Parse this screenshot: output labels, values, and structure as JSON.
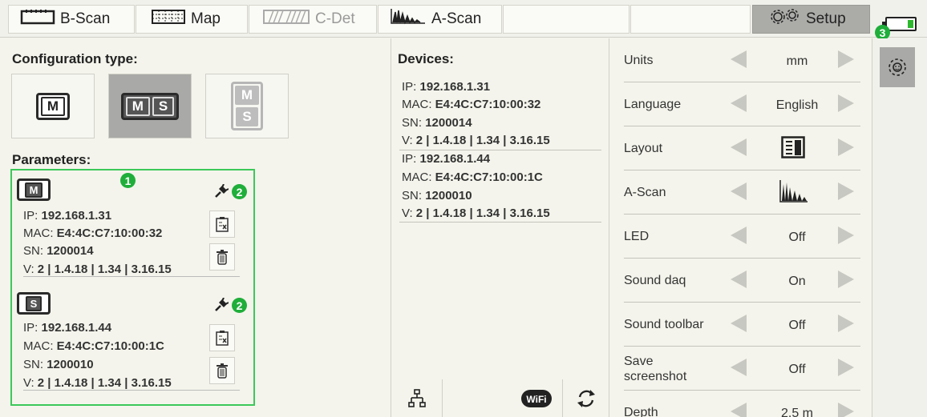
{
  "toolbar": {
    "tabs": [
      {
        "label": "B-Scan",
        "icon": "bscan-icon",
        "state": "normal"
      },
      {
        "label": "Map",
        "icon": "map-icon",
        "state": "normal"
      },
      {
        "label": "C-Det",
        "icon": "cdet-icon",
        "state": "disabled"
      },
      {
        "label": "A-Scan",
        "icon": "ascan-icon",
        "state": "normal"
      },
      {
        "label": "Setup",
        "icon": "gears-icon",
        "state": "active"
      }
    ],
    "battery_badge": "3",
    "battery_level_fraction": 0.2
  },
  "config": {
    "title": "Configuration type:",
    "options": [
      {
        "cells": [
          "M"
        ],
        "state": "normal"
      },
      {
        "cells": [
          "M",
          "S"
        ],
        "state": "selected"
      },
      {
        "cells": [
          "M",
          "S"
        ],
        "state": "disabled"
      }
    ]
  },
  "parameters": {
    "title": "Parameters:",
    "box_badge": "1",
    "devices": [
      {
        "type": "M",
        "badge": "2",
        "ip_label": "IP:",
        "ip": "192.168.1.31",
        "mac_label": "MAC:",
        "mac": "E4:4C:C7:10:00:32",
        "sn_label": "SN:",
        "sn": "1200014",
        "v_label": "V:",
        "v": "2 | 1.4.18 | 1.34 | 3.16.15"
      },
      {
        "type": "S",
        "badge": "2",
        "ip_label": "IP:",
        "ip": "192.168.1.44",
        "mac_label": "MAC:",
        "mac": "E4:4C:C7:10:00:1C",
        "sn_label": "SN:",
        "sn": "1200010",
        "v_label": "V:",
        "v": "2 | 1.4.18 | 1.34 | 3.16.15"
      }
    ]
  },
  "devices": {
    "title": "Devices:",
    "list": [
      {
        "ip_label": "IP:",
        "ip": "192.168.1.31",
        "mac_label": "MAC:",
        "mac": "E4:4C:C7:10:00:32",
        "sn_label": "SN:",
        "sn": "1200014",
        "v_label": "V:",
        "v": "2 | 1.4.18 | 1.34 | 3.16.15"
      },
      {
        "ip_label": "IP:",
        "ip": "192.168.1.44",
        "mac_label": "MAC:",
        "mac": "E4:4C:C7:10:00:1C",
        "sn_label": "SN:",
        "sn": "1200010",
        "v_label": "V:",
        "v": "2 | 1.4.18 | 1.34 | 3.16.15"
      }
    ],
    "wifi_label": "WiFi"
  },
  "settings": {
    "rows": [
      {
        "label": "Units",
        "value": "mm"
      },
      {
        "label": "Language",
        "value": "English"
      },
      {
        "label": "Layout",
        "value": "",
        "icon": "layout-icon"
      },
      {
        "label": "A-Scan",
        "value": "",
        "icon": "ascan-waveform-icon"
      },
      {
        "label": "LED",
        "value": "Off"
      },
      {
        "label": "Sound daq",
        "value": "On"
      },
      {
        "label": "Sound toolbar",
        "value": "Off"
      },
      {
        "label": "Save screenshot",
        "value": "Off"
      },
      {
        "label": "Depth",
        "value": "2.5 m"
      }
    ]
  },
  "sidetab": {
    "icon": "settings-gear-icon"
  }
}
